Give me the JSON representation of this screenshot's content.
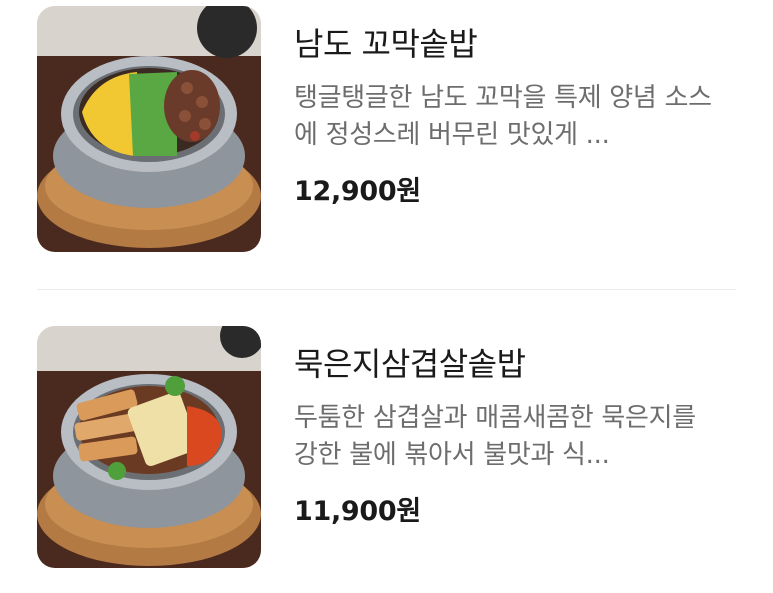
{
  "menu": {
    "items": [
      {
        "name": "남도 꼬막솥밥",
        "description": "탱글탱글한 남도 꼬막을 특제 양념 소스에 정성스레 버무린 맛있게 ...",
        "price": "12,900원",
        "image_icon": "cockle-rice-pot-photo"
      },
      {
        "name": "묵은지삼겹살솥밥",
        "description": "두툼한 삼겹살과 매콤새콤한 묵은지를 강한 불에 볶아서 불맛과 식...",
        "price": "11,900원",
        "image_icon": "pork-kimchi-rice-pot-photo"
      }
    ]
  }
}
